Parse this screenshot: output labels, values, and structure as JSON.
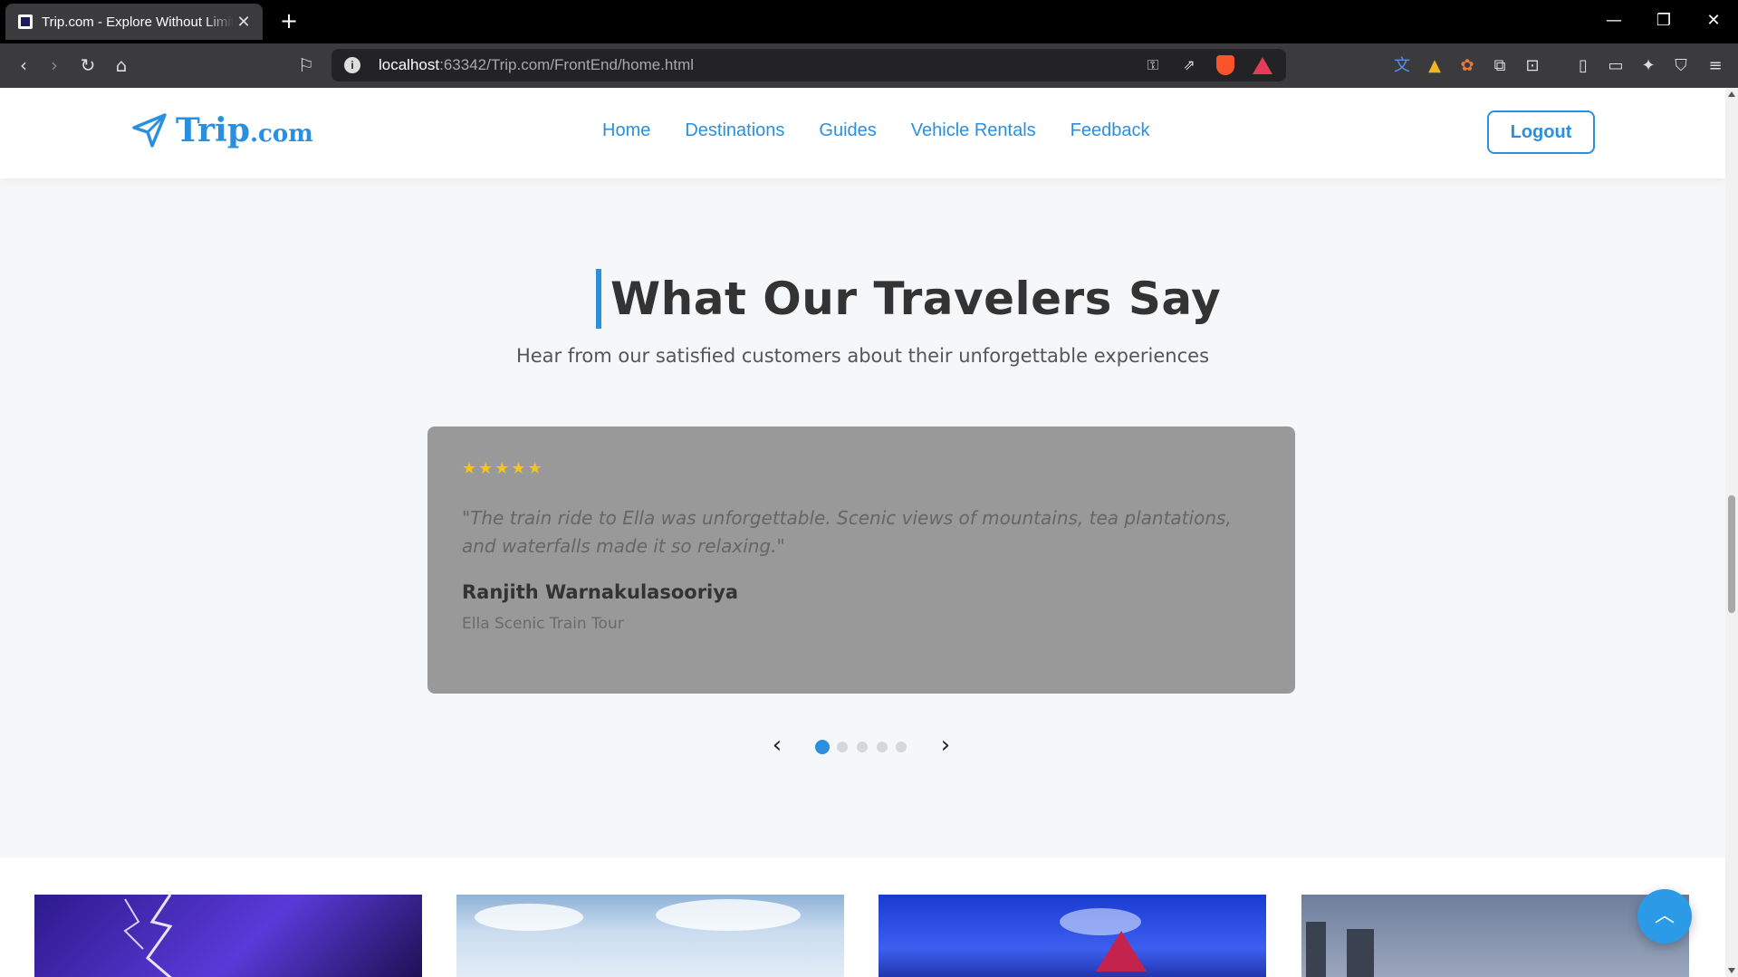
{
  "browser": {
    "tab_title": "Trip.com - Explore Without Limits",
    "url_host": "localhost",
    "url_path": ":63342/Trip.com/FrontEnd/home.html"
  },
  "header": {
    "logo_main": "Trip",
    "logo_suffix": ".com",
    "nav": [
      "Home",
      "Destinations",
      "Guides",
      "Vehicle Rentals",
      "Feedback"
    ],
    "logout_label": "Logout"
  },
  "testimonials": {
    "title": "What Our Travelers Say",
    "subtitle": "Hear from our satisfied customers about their unforgettable experiences",
    "current": {
      "rating": 5,
      "stars": "★★★★★",
      "quote": "\"The train ride to Ella was unforgettable. Scenic views of mountains, tea plantations, and waterfalls made it so relaxing.\"",
      "name": "Ranjith Warnakulasooriya",
      "tour": "Ella Scenic Train Tour"
    },
    "slide_count": 5,
    "active_slide": 1
  },
  "colors": {
    "accent": "#2b8fe0",
    "star": "#f5c518",
    "card": "#999999"
  }
}
